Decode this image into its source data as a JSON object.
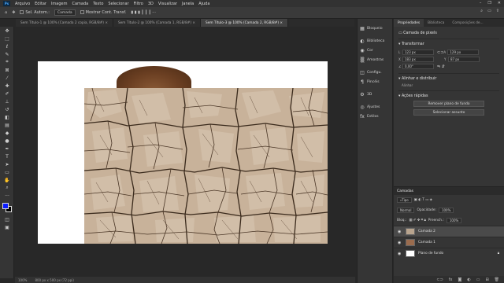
{
  "menu": {
    "logo": "Ps",
    "items": [
      "Arquivo",
      "Editar",
      "Imagem",
      "Camada",
      "Texto",
      "Selecionar",
      "Filtro",
      "3D",
      "Visualizar",
      "Janela",
      "Ajuda"
    ],
    "window_controls": [
      "–",
      "❐",
      "✕"
    ]
  },
  "options": {
    "auto_select": "Sel. Autom.:",
    "layer_select": "Camada",
    "show_transform": "Mostrar Cont. Transf."
  },
  "tabs": [
    {
      "label": "Sem Título-1 @ 100% (Camada 2 copia, RGB/8#) ×",
      "active": false
    },
    {
      "label": "Sem Título-2 @ 100% (Camada 1, RGB/8#) ×",
      "active": false
    },
    {
      "label": "Sem Título-3 @ 100% (Camada 2, RGB/8#) ×",
      "active": true
    }
  ],
  "status": {
    "zoom": "100%",
    "doc_size": "800 px x 500 px (72 ppi)"
  },
  "mid_panel": {
    "items": [
      {
        "icon": "▦",
        "label": "Bloqueio",
        "icon_name": "lock-panel-icon"
      },
      {
        "icon": "◐",
        "label": "Biblioteca",
        "icon_name": "library-icon"
      },
      {
        "icon": "◉",
        "label": "Cor",
        "icon_name": "color-icon"
      },
      {
        "icon": "▒",
        "label": "Amostras",
        "icon_name": "swatches-icon"
      },
      {
        "icon": "◫",
        "label": "Configu.",
        "icon_name": "settings-icon"
      },
      {
        "icon": "¶",
        "label": "Pincéis",
        "icon_name": "brush-icon"
      },
      {
        "icon": "⚙",
        "label": "3D",
        "icon_name": "3d-icon"
      },
      {
        "icon": "◎",
        "label": "Ajustes",
        "icon_name": "adjustments-icon"
      },
      {
        "icon": "fx",
        "label": "Estilos",
        "icon_name": "styles-icon"
      }
    ]
  },
  "props": {
    "tabs": [
      "Propriedades",
      "Biblioteca",
      "Composições de..."
    ],
    "layer_title": "Camada de pixels",
    "transform_title": "Transformar",
    "w": "123 px",
    "h": "129 px",
    "x": "183 px",
    "y": "87 px",
    "angle": "0,00°",
    "align_title": "Alinhar e distribuir",
    "align_sub": "Alinhar",
    "quick_title": "Ações rápidas",
    "btn_remove": "Remover plano de fundo",
    "btn_select": "Selecionar assunto"
  },
  "layers": {
    "tab": "Camadas",
    "filter": "Tipo",
    "blend": "Normal",
    "opacity_label": "Opacidade:",
    "opacity": "100%",
    "lock_label": "Bloq.:",
    "fill_label": "Preench.:",
    "fill": "100%",
    "items": [
      {
        "name": "Camada 2",
        "thumb": "tex",
        "selected": true
      },
      {
        "name": "Camada 1",
        "thumb": "img",
        "selected": false
      },
      {
        "name": "Plano de fundo",
        "thumb": "white",
        "selected": false
      }
    ]
  }
}
